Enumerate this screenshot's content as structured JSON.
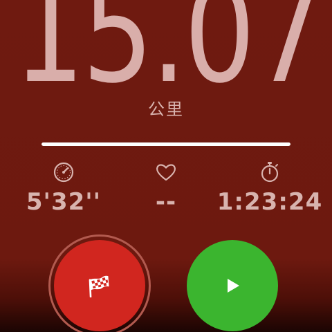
{
  "workout": {
    "distance": "15.07",
    "unit": "公里",
    "progress": 1.0
  },
  "stats": {
    "pace": {
      "icon": "speedometer-icon",
      "value": "5'32''"
    },
    "heart_rate": {
      "icon": "heart-icon",
      "value": "--"
    },
    "duration": {
      "icon": "stopwatch-icon",
      "value": "1:23:24"
    }
  },
  "controls": {
    "finish": {
      "icon": "checkered-flag-icon",
      "color": "#d1261f"
    },
    "resume": {
      "icon": "play-icon",
      "color": "#3bb52f"
    }
  },
  "theme": {
    "background": "#6f1a10",
    "text": "#d8b3ae"
  }
}
